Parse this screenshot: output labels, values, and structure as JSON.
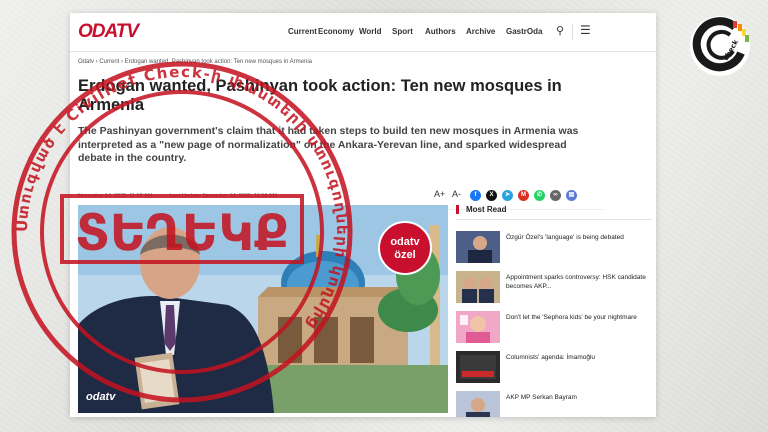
{
  "site": {
    "logo": "ODATV",
    "nav": [
      "Current",
      "Economy",
      "World",
      "Sport",
      "Authors",
      "Archive",
      "GastrOda"
    ]
  },
  "article": {
    "breadcrumb": "Odatv › Current › Erdogan wanted, Pashinyan took action: Ten new mosques in Armenia",
    "headline": "Erdogan wanted, Pashinyan took action: Ten new mosques in Armenia",
    "lede": "The Pashinyan government's claim that it had taken steps to build ten new mosques in Armenia was interpreted as a \"new page of normalization\" on the Ankara-Yerevan line, and sparked widespread debate in the country.",
    "published": "November 14, 2025, 11:58 AM",
    "updated": "Last Update: November 14, 2025, 11:58 AM",
    "font_up": "A+",
    "font_down": "A-",
    "hero_badge": "odatv\nözel",
    "hero_logo": "odatv"
  },
  "share_icons": [
    {
      "name": "facebook-icon",
      "glyph": "f",
      "color": "#1877f2"
    },
    {
      "name": "x-icon",
      "glyph": "X",
      "color": "#111111"
    },
    {
      "name": "telegram-icon",
      "glyph": "➤",
      "color": "#2aa3df"
    },
    {
      "name": "gmail-icon",
      "glyph": "M",
      "color": "#d93025"
    },
    {
      "name": "whatsapp-icon",
      "glyph": "✆",
      "color": "#25d366"
    },
    {
      "name": "link-icon",
      "glyph": "∞",
      "color": "#666666"
    },
    {
      "name": "print-icon",
      "glyph": "▤",
      "color": "#5b7bd5"
    }
  ],
  "most_read": {
    "title": "Most Read",
    "items": [
      "Özgür Özel's 'language' is being debated",
      "Appointment sparks controversy: HSK candidate becomes AKP...",
      "Don't let the 'Sephora kids' be your nightmare",
      "Columnists' agenda: İmamoğlu",
      "AKP MP Serkan Bayram"
    ]
  },
  "stamp": {
    "verdict": "ՏԵՂԵԿՔ",
    "ring_text": "Ստուգված է CivilNet Check-ի փաստերի ստուգողների կողմից"
  },
  "brand": {
    "name": "check",
    "accent": "#e53935"
  }
}
